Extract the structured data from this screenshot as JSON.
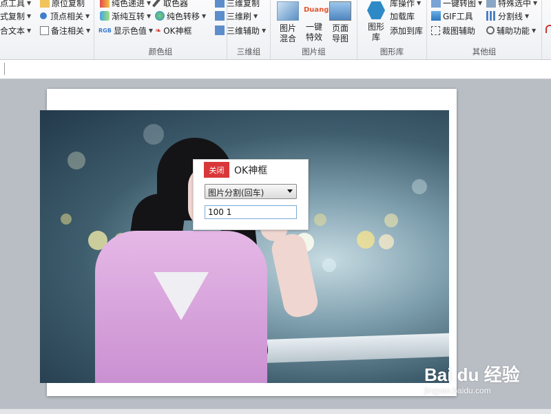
{
  "ribbon": {
    "col1": [
      "点工具",
      "式复制",
      "合文本"
    ],
    "col2": [
      "原位复制",
      "顶点相关",
      "备注相关"
    ],
    "color_group": {
      "label": "颜色组",
      "items": [
        "纯色递进",
        "渐纯互转",
        "显示色值",
        "取色器",
        "纯色转移",
        "OK神框"
      ]
    },
    "three_d_group": {
      "label": "三维组",
      "items": [
        "三维复制",
        "三维刷",
        "三维辅助"
      ]
    },
    "picture_group": {
      "label": "图片组",
      "buttons": [
        "图片\n混合",
        "一键\n特效",
        "页面\n导图"
      ],
      "duang": "Duang"
    },
    "shape_group": {
      "label": "图形库",
      "big": "图形\n库",
      "items": [
        "库操作",
        "加载库",
        "添加到库"
      ]
    },
    "other_group": {
      "label": "其他组",
      "items": [
        "一键转图",
        "GIF工具",
        "裁图辅助",
        "特殊选中",
        "分割线",
        "辅助功能"
      ]
    }
  },
  "dialog": {
    "close_label": "关闭",
    "title": "OK神框",
    "select_value": "图片分割(回车)",
    "input_value": "100 1"
  },
  "watermark": {
    "line1": "Bai du 经验",
    "line2": "jingyan.baidu.com"
  },
  "colors": {
    "close_red": "#d9383a",
    "input_border": "#7aa9d6"
  }
}
